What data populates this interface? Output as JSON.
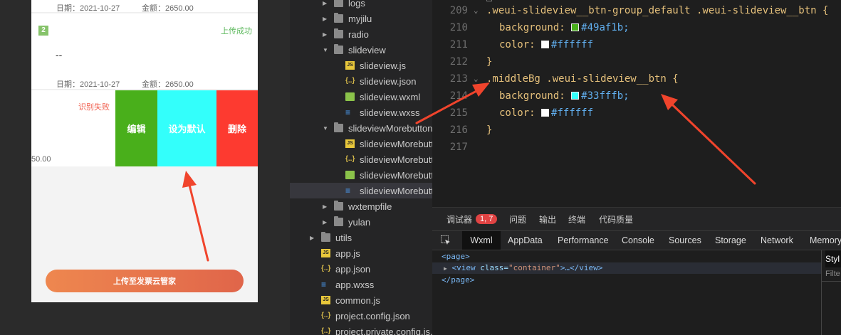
{
  "simulator": {
    "card1": {
      "date": "日期：2021-10-27",
      "amount": "金额：2650.00"
    },
    "card2": {
      "badge": "2",
      "status": "上传成功",
      "text": "--",
      "date": "日期：2021-10-27",
      "amount": "金额：2650.00"
    },
    "card3": {
      "status": "识别失败",
      "amount": "50.00"
    },
    "swipe_buttons": {
      "edit": "编辑",
      "set_default": "设为默认",
      "delete": "删除"
    },
    "upload_button": "上传至发票云管家",
    "colors": {
      "success": "#5cb85c",
      "fail": "#f05b4a",
      "edit_bg": "#49af1b",
      "default_bg": "#33fffb",
      "delete_bg": "#fd3a30"
    }
  },
  "file_tree": [
    {
      "label": "logs",
      "type": "folder",
      "expanded": false
    },
    {
      "label": "myjilu",
      "type": "folder",
      "expanded": false
    },
    {
      "label": "radio",
      "type": "folder",
      "expanded": false
    },
    {
      "label": "slideview",
      "type": "folder",
      "expanded": true
    },
    {
      "label": "slideview.js",
      "type": "js"
    },
    {
      "label": "slideview.json",
      "type": "json"
    },
    {
      "label": "slideview.wxml",
      "type": "wxml"
    },
    {
      "label": "slideview.wxss",
      "type": "wxss"
    },
    {
      "label": "slideviewMorebutton",
      "type": "folder",
      "expanded": true
    },
    {
      "label": "slideviewMorebutto...",
      "type": "js"
    },
    {
      "label": "slideviewMorebutto...",
      "type": "json"
    },
    {
      "label": "slideviewMorebutto...",
      "type": "wxml"
    },
    {
      "label": "slideviewMorebutto...",
      "type": "wxss",
      "selected": true
    },
    {
      "label": "wxtempfile",
      "type": "folder",
      "expanded": false
    },
    {
      "label": "yulan",
      "type": "folder",
      "expanded": false
    },
    {
      "label": "utils",
      "type": "folder",
      "expanded": false
    },
    {
      "label": "app.js",
      "type": "js"
    },
    {
      "label": "app.json",
      "type": "json"
    },
    {
      "label": "app.wxss",
      "type": "wxss"
    },
    {
      "label": "common.js",
      "type": "js"
    },
    {
      "label": "project.config.json",
      "type": "json"
    },
    {
      "label": "project.private.config.js...",
      "type": "json"
    }
  ],
  "editor": {
    "lines": [
      {
        "num": "209",
        "fold": true,
        "selector": ".weui-slideview__btn-group_default .weui-slideview__btn {"
      },
      {
        "num": "210",
        "prop": "background:",
        "swatch": "#49af1b",
        "value": "#49af1b;"
      },
      {
        "num": "211",
        "prop": "color:",
        "swatch": "#ffffff",
        "value": "#ffffff"
      },
      {
        "num": "212",
        "brace": "}"
      },
      {
        "num": "213",
        "fold": true,
        "selector": ".middleBg .weui-slideview__btn {"
      },
      {
        "num": "214",
        "prop": "background:",
        "swatch": "#33fffb",
        "value": "#33fffb;"
      },
      {
        "num": "215",
        "prop": "color:",
        "swatch": "#ffffff",
        "value": "#ffffff"
      },
      {
        "num": "216",
        "brace": "}"
      },
      {
        "num": "217"
      }
    ]
  },
  "devtools": {
    "top_tabs": [
      "调试器",
      "问题",
      "输出",
      "终端",
      "代码质量"
    ],
    "badge": "1, 7",
    "panel_tabs": [
      "Wxml",
      "AppData",
      "Performance",
      "Console",
      "Sources",
      "Storage",
      "Network",
      "Memory"
    ],
    "active_panel": "Wxml",
    "xml": {
      "page_open": "<page>",
      "view_open": "<view",
      "attr_name": "class=",
      "attr_value": "\"container\"",
      "view_rest": ">…</view>",
      "page_close": "</page>"
    },
    "styles_tab": "Styl",
    "filter": "Filte"
  }
}
